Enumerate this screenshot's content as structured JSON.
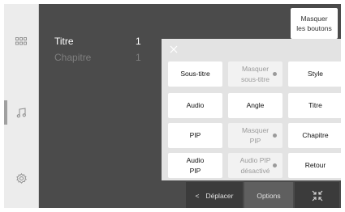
{
  "header": {
    "hide_buttons_label": "Masquer\nles boutons"
  },
  "rows": [
    {
      "label": "Titre",
      "value": "1"
    },
    {
      "label": "Chapitre",
      "value": "1"
    }
  ],
  "sidebar": {
    "items": [
      {
        "icon": "grid-icon"
      },
      {
        "icon": "music-note-icon"
      },
      {
        "icon": "settings-gear-icon"
      }
    ]
  },
  "panel": {
    "buttons": {
      "subtitle": "Sous-titre",
      "hide_subtitle": "Masquer\nsous-titre",
      "style": "Style",
      "audio": "Audio",
      "angle": "Angle",
      "title": "Titre",
      "pip": "PIP",
      "hide_pip": "Masquer\nPIP",
      "chapter": "Chapitre",
      "audio_pip": "Audio\nPIP",
      "audio_pip_off": "Audio PIP\ndésactivé",
      "back": "Retour"
    }
  },
  "bottom": {
    "move": "Déplacer",
    "move_icon": "<",
    "options": "Options",
    "collapse_icon": "collapse-icon"
  }
}
